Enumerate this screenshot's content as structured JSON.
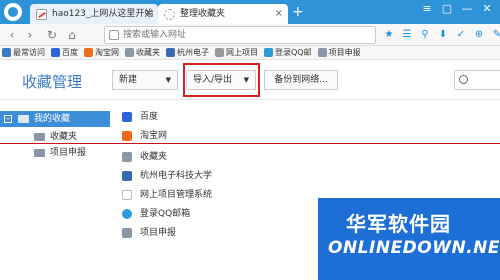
{
  "browser": {
    "tabs": [
      {
        "label": "hao123_上网从这里开始",
        "close": "×"
      },
      {
        "label": "整理收藏夹",
        "close": "×"
      }
    ],
    "new_tab": "+",
    "window_controls": [
      "≡",
      "▢",
      "—",
      "✕"
    ]
  },
  "nav": {
    "back": "‹",
    "forward": "›",
    "refresh": "↻",
    "home": "⌂",
    "url_placeholder": "搜索或输入网址",
    "tool_icons": [
      "★",
      "☰",
      "⚲",
      "⬇",
      "✓",
      "⊕",
      "✎"
    ]
  },
  "bookmarks": [
    {
      "label": "最常访问",
      "color": "#3a7cc4"
    },
    {
      "label": "百度",
      "color": "#2b65d9"
    },
    {
      "label": "淘宝网",
      "color": "#f26a1b"
    },
    {
      "label": "收藏夹",
      "color": "#8a97a6"
    },
    {
      "label": "杭州电子",
      "color": "#3a6bb0"
    },
    {
      "label": "网上项目",
      "color": "#999999"
    },
    {
      "label": "登录QQ邮",
      "color": "#2b9bd9"
    },
    {
      "label": "项目申报",
      "color": "#8a97a6"
    }
  ],
  "header": {
    "title": "收藏管理",
    "new_label": "新建",
    "import_export_label": "导入/导出",
    "backup_label": "备份到网络...",
    "caret": "▼"
  },
  "sidebar": {
    "items": [
      {
        "label": "我的收藏",
        "expander": "−"
      },
      {
        "label": "收藏夹"
      },
      {
        "label": "项目申报"
      }
    ]
  },
  "list": {
    "items": [
      {
        "label": "百度",
        "icon": "baidu-icon",
        "color": "#2b65d9"
      },
      {
        "label": "淘宝网",
        "icon": "taobao-icon",
        "color": "#f26a1b"
      },
      {
        "label": "收藏夹",
        "icon": "folder-icon",
        "color": "#8a97a6"
      },
      {
        "label": "杭州电子科技大学",
        "icon": "university-icon",
        "color": "#3a6bb0"
      },
      {
        "label": "网上项目管理系统",
        "icon": "page-icon",
        "color": "#bbbbbb"
      },
      {
        "label": "登录QQ邮箱",
        "icon": "qq-mail-icon",
        "color": "#2b9bd9"
      },
      {
        "label": "项目申报",
        "icon": "folder-icon",
        "color": "#8a97a6"
      }
    ]
  },
  "watermark": {
    "cn": "华军软件园",
    "en": "ONLINEDOWN.NET"
  }
}
